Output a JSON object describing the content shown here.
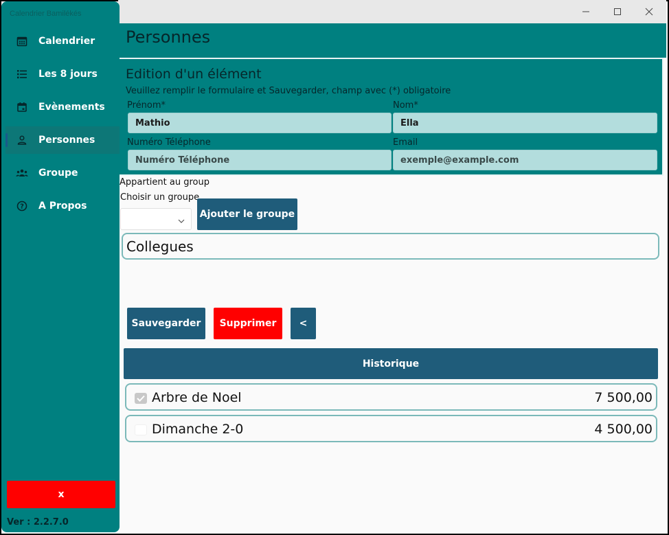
{
  "app": {
    "title": "Calendrier Bamilékés",
    "version": "Ver : 2.2.7.0"
  },
  "sidebar": {
    "items": [
      {
        "label": "Calendrier",
        "icon": "calendar-icon"
      },
      {
        "label": "Les 8  jours",
        "icon": "list-icon"
      },
      {
        "label": "Evènements",
        "icon": "event-icon"
      },
      {
        "label": "Personnes",
        "icon": "person-icon",
        "active": true
      },
      {
        "label": "Groupe",
        "icon": "group-icon"
      },
      {
        "label": "A Propos",
        "icon": "help-icon"
      }
    ],
    "close_label": "x"
  },
  "header": {
    "title": "Personnes"
  },
  "form": {
    "title": "Edition d'un élément",
    "subtitle": "Veuillez remplir le formulaire et Sauvegarder, champ avec (*) obligatoire",
    "first_name": {
      "label": "Prénom*",
      "value": "Mathio"
    },
    "last_name": {
      "label": "Nom*",
      "value": "Ella"
    },
    "phone": {
      "label": "Numéro Téléphone",
      "placeholder": "Numéro Téléphone"
    },
    "email": {
      "label": "Email",
      "placeholder": "exemple@example.com"
    }
  },
  "group": {
    "label": "Appartient au group",
    "choose_label": "Choisir un groupe",
    "add_button": "Ajouter le groupe",
    "items": [
      "Collegues"
    ]
  },
  "actions": {
    "save": "Sauvegarder",
    "delete": "Supprimer",
    "back": "<"
  },
  "history": {
    "title": "Historique",
    "rows": [
      {
        "name": "Arbre de Noel",
        "amount": "7 500,00",
        "checked": true
      },
      {
        "name": "Dimanche 2-0",
        "amount": "4 500,00",
        "checked": false
      }
    ]
  },
  "colors": {
    "teal": "#008080",
    "dark_blue": "#1f5c7a",
    "red": "#ff0000"
  }
}
